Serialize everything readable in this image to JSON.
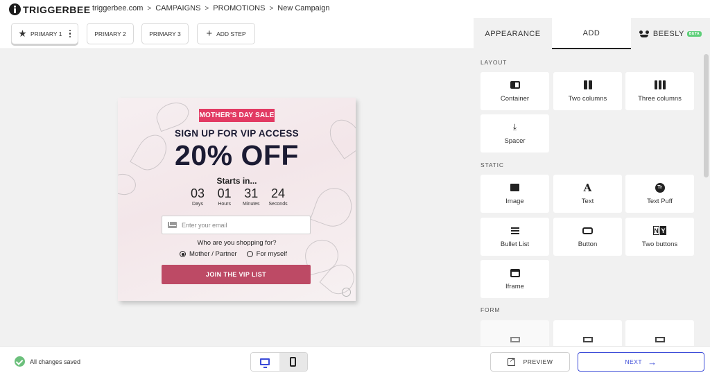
{
  "app": {
    "logo_text": "TRIGGERBEE"
  },
  "breadcrumb": {
    "items": [
      "triggerbee.com",
      "CAMPAIGNS",
      "PROMOTIONS",
      "New Campaign"
    ],
    "separator": ">"
  },
  "steps": {
    "items": [
      {
        "label": "PRIMARY 1",
        "active": true
      },
      {
        "label": "PRIMARY 2",
        "active": false
      },
      {
        "label": "PRIMARY 3",
        "active": false
      }
    ],
    "add_label": "ADD STEP"
  },
  "tabs": {
    "appearance": "APPEARANCE",
    "add": "ADD",
    "beesly": "BEESLY",
    "beta": "BETA",
    "active": "ADD"
  },
  "popup": {
    "badge": "MOTHER'S DAY SALE",
    "headline": "SIGN UP FOR VIP ACCESS",
    "offer": "20% OFF",
    "starts": "Starts in...",
    "countdown": [
      {
        "value": "03",
        "label": "Days"
      },
      {
        "value": "01",
        "label": "Hours"
      },
      {
        "value": "31",
        "label": "Minutes"
      },
      {
        "value": "24",
        "label": "Seconds"
      }
    ],
    "email_placeholder": "Enter your email",
    "question": "Who are you shopping for?",
    "options": [
      {
        "label": "Mother / Partner",
        "selected": true
      },
      {
        "label": "For myself",
        "selected": false
      }
    ],
    "cta": "JOIN THE VIP LIST",
    "colors": {
      "badge": "#e23a63",
      "cta": "#bd4a65",
      "headline": "#1b1b33"
    }
  },
  "panel": {
    "sections": {
      "layout": "LAYOUT",
      "static": "STATIC",
      "form": "FORM"
    },
    "layout_items": [
      {
        "label": "Container",
        "icon": "container-icon"
      },
      {
        "label": "Two columns",
        "icon": "two-columns-icon"
      },
      {
        "label": "Three columns",
        "icon": "three-columns-icon"
      },
      {
        "label": "Spacer",
        "icon": "spacer-icon"
      }
    ],
    "static_items": [
      {
        "label": "Image",
        "icon": "image-icon"
      },
      {
        "label": "Text",
        "icon": "text-icon",
        "glyph": "A"
      },
      {
        "label": "Text Puff",
        "icon": "text-puff-icon",
        "glyph": "Tr"
      },
      {
        "label": "Bullet List",
        "icon": "bullet-list-icon"
      },
      {
        "label": "Button",
        "icon": "button-icon"
      },
      {
        "label": "Two buttons",
        "icon": "two-buttons-icon",
        "glyph_left": "N",
        "glyph_right": "Y"
      },
      {
        "label": "Iframe",
        "icon": "iframe-icon"
      }
    ]
  },
  "footer": {
    "status": "All changes saved",
    "preview": "PREVIEW",
    "next": "NEXT",
    "accent": "#3b4bd8",
    "status_color": "#6cc07c"
  }
}
